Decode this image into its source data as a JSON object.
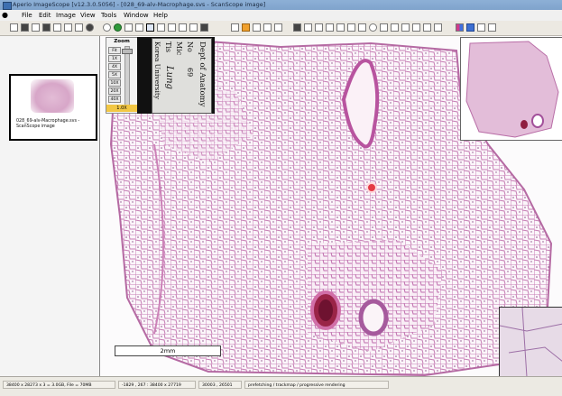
{
  "window": {
    "title": "Aperio ImageScope [v12.3.0.5056] - [028_69-alv-Macrophage.svs - ScanScope image]"
  },
  "menu": {
    "items": [
      "File",
      "Edit",
      "Image",
      "View",
      "Tools",
      "Window",
      "Help"
    ]
  },
  "sidebar": {
    "thumbnail": {
      "label": "028_69-alv-Macrophage.svs - ScanScope image"
    }
  },
  "zoom": {
    "title": "Zoom",
    "levels": [
      "Fit",
      "1X",
      "4X",
      "5X",
      "10X",
      "20X",
      "40X"
    ],
    "current": "1.0X"
  },
  "slide_label": {
    "line1": "Dept of Anatomy",
    "line2": "No",
    "line2_value": "69",
    "line3": "Mic",
    "line4": "Tis",
    "line4_value": "Lung",
    "line5": "Korea University"
  },
  "scale_bar": {
    "label": "2mm"
  },
  "statusbar": {
    "cells": [
      "38400 x 28273 x 3 = 3.0GB, File = 70MB",
      "-1829 , 267 : 38400 x 27719",
      "30003 , 26501",
      "prefetching / trackmap / progressive rendering"
    ]
  },
  "colors": {
    "titlebar": "#7fa3cc",
    "tissue": "#d49bc6",
    "zoom_current_bg": "#f2c744",
    "marker": "#e43a45"
  }
}
